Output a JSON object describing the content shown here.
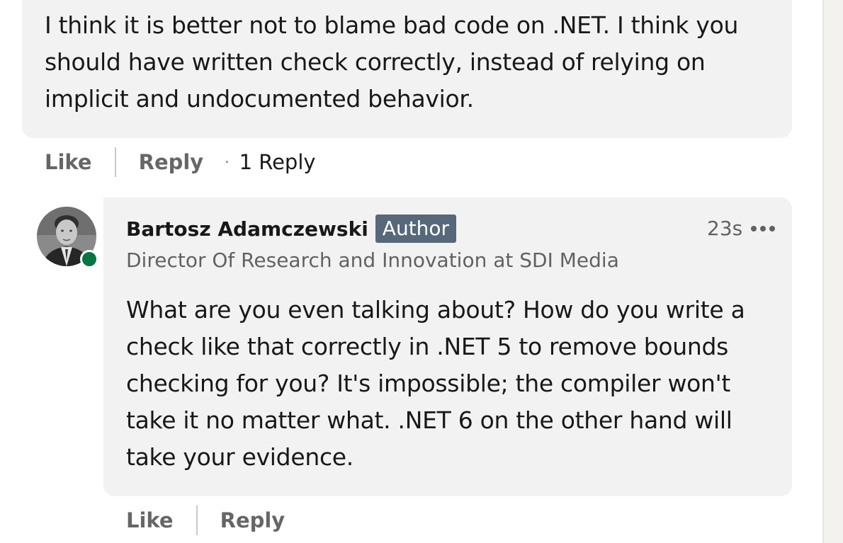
{
  "top_comment": {
    "text": "I think it is better not to blame bad code on .NET. I think you should have written check correctly, instead of relying on implicit and undocumented behavior.",
    "actions": {
      "like_label": "Like",
      "reply_label": "Reply",
      "reply_count": "1 Reply"
    }
  },
  "reply_comment": {
    "author": {
      "name": "Bartosz Adamczewski",
      "badge": "Author",
      "headline": "Director Of Research and Innovation at SDI Media",
      "online": true
    },
    "timestamp": "23s",
    "more_icon": "more-horizontal-icon",
    "text": "What are you even talking about? How do you write a check like that correctly in .NET 5 to remove bounds checking for you? It's impossible; the compiler won't take it no matter what. .NET 6 on the other hand will take your evidence.",
    "actions": {
      "like_label": "Like",
      "reply_label": "Reply"
    }
  },
  "colors": {
    "bubble_background": "#f2f2f2",
    "badge_background": "#56687a",
    "presence_green": "#057642",
    "secondary_text": "#666666"
  }
}
